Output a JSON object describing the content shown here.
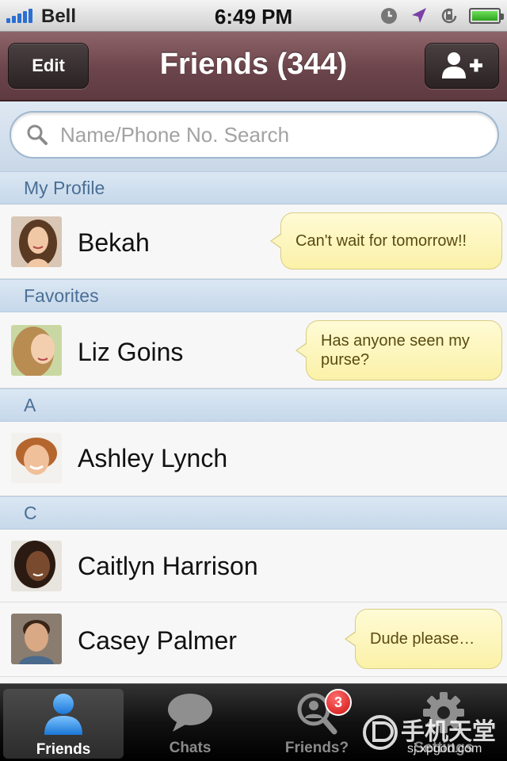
{
  "status_bar": {
    "carrier": "Bell",
    "time": "6:49 PM",
    "icons": [
      "clock-icon",
      "location-arrow-icon",
      "rotation-lock-icon",
      "battery-icon"
    ]
  },
  "nav": {
    "edit_label": "Edit",
    "title": "Friends (344)",
    "add_friend_icon": "add-person-icon"
  },
  "search": {
    "placeholder": "Name/Phone No. Search"
  },
  "sections": {
    "my_profile": "My Profile",
    "favorites": "Favorites",
    "a": "A",
    "c": "C"
  },
  "friends": [
    {
      "name": "Bekah",
      "status": "Can't wait for tomorrow!!"
    },
    {
      "name": "Liz Goins",
      "status": "Has anyone seen my purse?"
    },
    {
      "name": "Ashley Lynch",
      "status": ""
    },
    {
      "name": "Caitlyn Harrison",
      "status": ""
    },
    {
      "name": "Casey Palmer",
      "status": "Dude please…"
    }
  ],
  "tabs": [
    {
      "label": "Friends",
      "icon": "person-icon",
      "active": true
    },
    {
      "label": "Chats",
      "icon": "speech-bubble-icon"
    },
    {
      "label": "Friends?",
      "icon": "search-person-icon",
      "badge": "3"
    },
    {
      "label": "Settings",
      "icon": "gear-icon"
    }
  ],
  "watermark": {
    "text": "手机天堂",
    "url": "sj.xpgod.com"
  },
  "colors": {
    "nav_bar": "#6b454b",
    "section_header": "#c6d8ea",
    "bubble": "#fbf1a8",
    "badge": "#d11212"
  }
}
